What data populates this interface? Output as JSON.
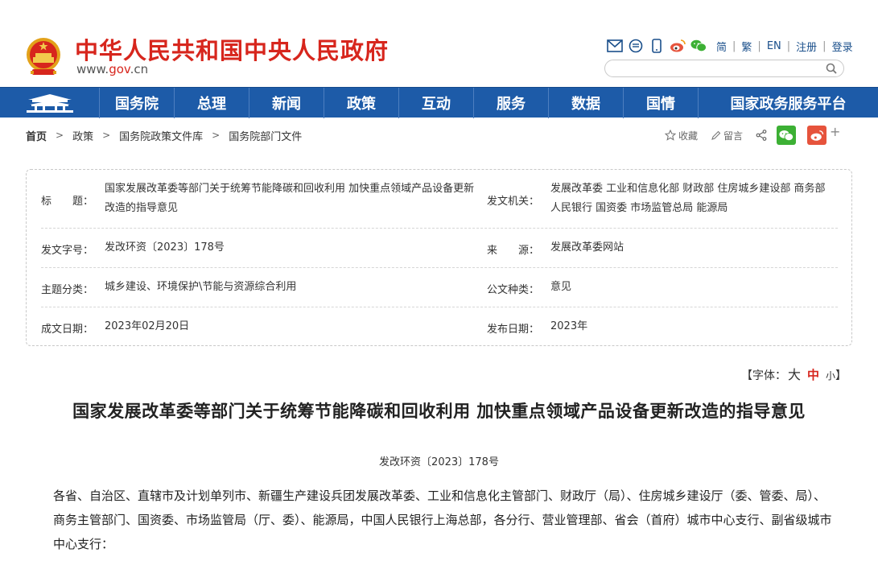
{
  "header": {
    "site_title": "中华人民共和国中央人民政府",
    "domain_prefix": "www.",
    "domain_highlight": "gov",
    "domain_suffix": ".cn",
    "lang_links": [
      "简",
      "繁",
      "EN",
      "注册",
      "登录"
    ],
    "search_placeholder": ""
  },
  "nav": {
    "items": [
      "国务院",
      "总理",
      "新闻",
      "政策",
      "互动",
      "服务",
      "数据",
      "国情",
      "国家政务服务平台"
    ]
  },
  "breadcrumb": [
    "首页",
    "政策",
    "国务院政策文件库",
    "国务院部门文件"
  ],
  "share": {
    "favorite": "收藏",
    "comment": "留言"
  },
  "info_table": {
    "title_label": "标　　题：",
    "title_value": "国家发展改革委等部门关于统筹节能降碳和回收利用 加快重点领域产品设备更新改造的指导意见",
    "issuer_label": "发文机关：",
    "issuer_value": "发展改革委 工业和信息化部 财政部 住房城乡建设部 商务部 人民银行 国资委 市场监管总局 能源局",
    "docno_label": "发文字号：",
    "docno_value": "发改环资〔2023〕178号",
    "source_label": "来　　源：",
    "source_value": "发展改革委网站",
    "topic_label": "主题分类：",
    "topic_value": "城乡建设、环境保护\\节能与资源综合利用",
    "type_label": "公文种类：",
    "type_value": "意见",
    "created_label": "成文日期：",
    "created_value": "2023年02月20日",
    "published_label": "发布日期：",
    "published_value": "2023年"
  },
  "font_size": {
    "prefix": "【字体：",
    "big": "大",
    "medium": "中",
    "small": "小",
    "suffix": "】"
  },
  "article": {
    "title": "国家发展改革委等部门关于统筹节能降碳和回收利用 加快重点领域产品设备更新改造的指导意见",
    "doc_number": "发改环资〔2023〕178号",
    "body": "各省、自治区、直辖市及计划单列市、新疆生产建设兵团发展改革委、工业和信息化主管部门、财政厅（局）、住房城乡建设厅（委、管委、局）、商务主管部门、国资委、市场监管局（厅、委）、能源局，中国人民银行上海总部，各分行、营业管理部、省会（首府）城市中心支行、副省级城市中心支行："
  },
  "colors": {
    "brand_red": "#d7261d",
    "nav_blue": "#1d5ba8",
    "wechat_green": "#3cb034",
    "weibo_red": "#e6533c"
  }
}
